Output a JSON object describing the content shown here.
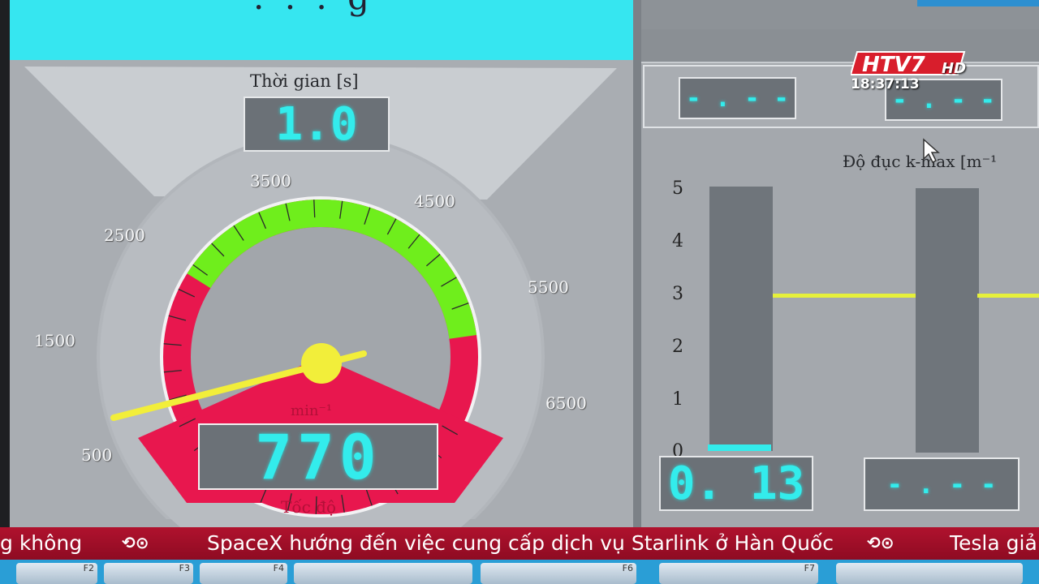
{
  "title_band": {
    "partial_text": ". . . g"
  },
  "time_panel": {
    "label": "Thời gian [s]",
    "value": "1.0"
  },
  "gauge": {
    "tick_labels": [
      "500",
      "1500",
      "2500",
      "3500",
      "4500",
      "5500",
      "6500"
    ],
    "unit": "min⁻¹",
    "speed_value": "770",
    "speed_label": "Tốc độ",
    "colors": {
      "red": "#e8174e",
      "green": "#6fee1c",
      "needle": "#f2ee3a"
    }
  },
  "right_panel": {
    "top_display_left": "- . - -",
    "top_display_right": "- . - -",
    "chart_title": "Độ đục k-max [m⁻¹",
    "y_ticks": [
      "5",
      "4",
      "3",
      "2",
      "1",
      "0"
    ],
    "limit_line_color": "#e6f03a",
    "bottom_display_left": "0. 13",
    "bottom_display_right": "- . - -"
  },
  "chart_data": {
    "type": "bar",
    "title": "Độ đục k-max [m⁻¹",
    "categories": [
      "",
      ""
    ],
    "values": [
      0.13,
      0
    ],
    "ylim": [
      0,
      5
    ],
    "limit_line": 3
  },
  "ticker": {
    "items": [
      "g không",
      "SpaceX hướng đến việc cung cấp dịch vụ Starlink ở Hàn Quốc",
      "Tesla giả"
    ]
  },
  "function_keys": [
    "F2",
    "F3",
    "F4",
    "F6",
    "F7"
  ],
  "broadcaster": {
    "logo_text": "HTV7",
    "hd": "HD",
    "time": "18:37:13"
  }
}
